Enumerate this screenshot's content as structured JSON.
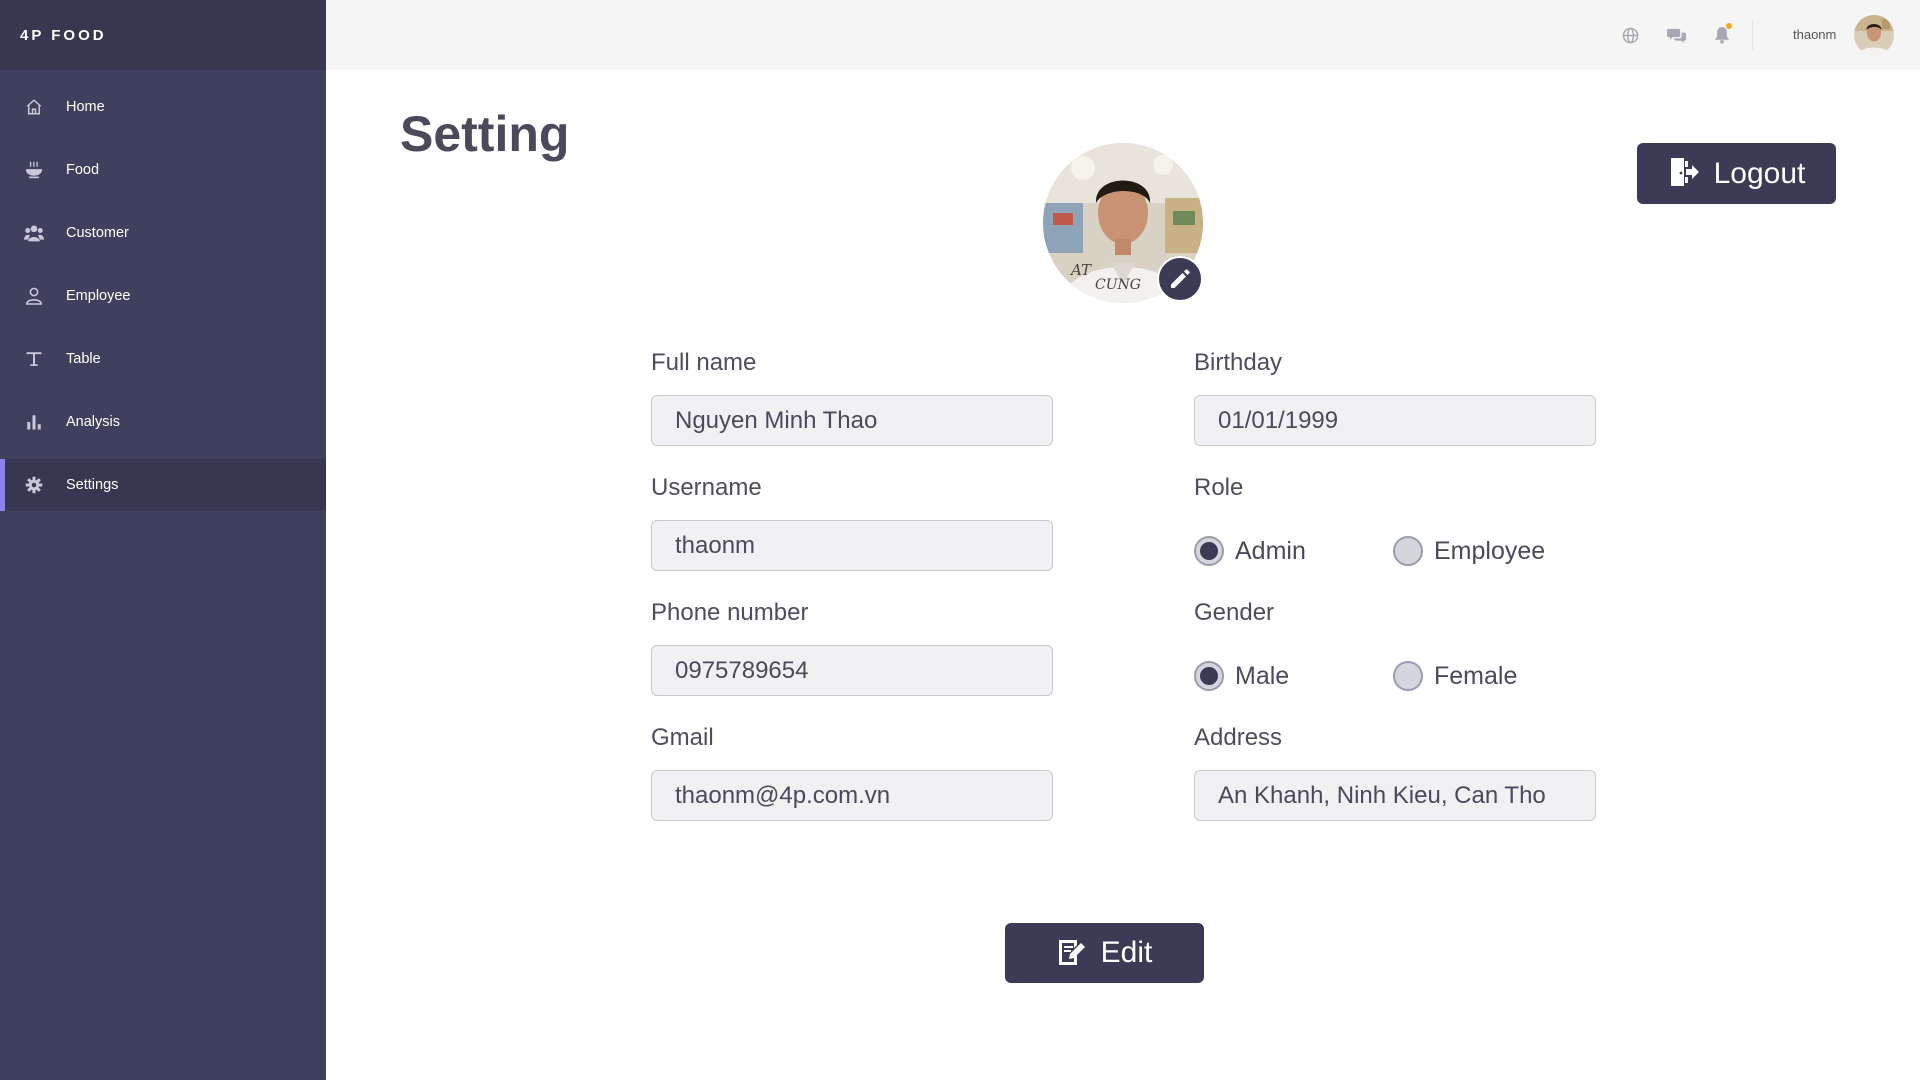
{
  "brand": "4P FOOD",
  "sidebar": {
    "items": [
      {
        "label": "Home",
        "icon": "home-icon"
      },
      {
        "label": "Food",
        "icon": "food-bowl-icon"
      },
      {
        "label": "Customer",
        "icon": "users-icon"
      },
      {
        "label": "Employee",
        "icon": "user-icon"
      },
      {
        "label": "Table",
        "icon": "table-icon"
      },
      {
        "label": "Analysis",
        "icon": "bar-chart-icon"
      },
      {
        "label": "Settings",
        "icon": "gear-icon",
        "active": true
      }
    ]
  },
  "header": {
    "username": "thaonm",
    "icons": [
      "globe-icon",
      "chat-icon",
      "bell-icon"
    ]
  },
  "page": {
    "title": "Setting",
    "logout_label": "Logout",
    "edit_label": "Edit"
  },
  "form": {
    "full_name": {
      "label": "Full name",
      "value": "Nguyen Minh Thao"
    },
    "username": {
      "label": "Username",
      "value": "thaonm"
    },
    "phone": {
      "label": "Phone number",
      "value": "0975789654"
    },
    "gmail": {
      "label": "Gmail",
      "value": "thaonm@4p.com.vn"
    },
    "birthday": {
      "label": "Birthday",
      "value": "01/01/1999"
    },
    "role": {
      "label": "Role",
      "options": [
        "Admin",
        "Employee"
      ],
      "selected": "Admin"
    },
    "gender": {
      "label": "Gender",
      "options": [
        "Male",
        "Female"
      ],
      "selected": "Male"
    },
    "address": {
      "label": "Address",
      "value": "An Khanh, Ninh Kieu, Can Tho"
    }
  },
  "colors": {
    "sidebar": "#3f3f5e",
    "accent": "#8b83e8",
    "button": "#3b3b56",
    "notification": "#f5a623"
  }
}
